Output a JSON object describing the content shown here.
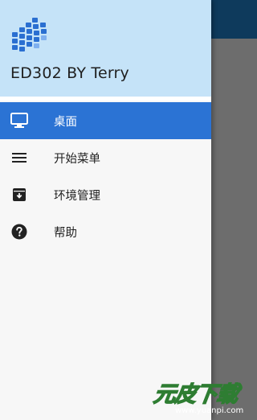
{
  "drawer": {
    "header_title": "ED302 BY Terry",
    "items": [
      {
        "label": "桌面",
        "icon": "monitor-icon",
        "active": true
      },
      {
        "label": "开始菜单",
        "icon": "menu-icon",
        "active": false
      },
      {
        "label": "环境管理",
        "icon": "archive-box-icon",
        "active": false
      },
      {
        "label": "帮助",
        "icon": "help-circle-icon",
        "active": false
      }
    ]
  },
  "watermark": {
    "brand": "元皮下载",
    "url": "www.yuanpi.com"
  },
  "colors": {
    "header_bg": "#c5e3f8",
    "active_bg": "#2b73d4",
    "toolbar": "#0e3a5c",
    "scrim": "#6b6b6b"
  }
}
